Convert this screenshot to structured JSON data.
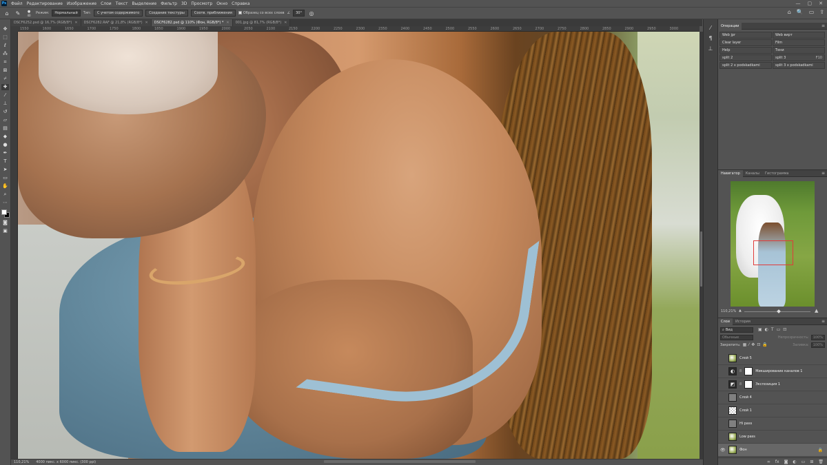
{
  "menubar": {
    "app_logo": "Ps",
    "items": [
      "Файл",
      "Редактирование",
      "Изображение",
      "Слои",
      "Текст",
      "Выделение",
      "Фильтр",
      "3D",
      "Просмотр",
      "Окно",
      "Справка"
    ],
    "controls": [
      "⌂",
      "🔍",
      "▭",
      "⇪",
      "—",
      "▢",
      "✕"
    ]
  },
  "options": {
    "brush_size": "40",
    "mode_label": "Режим:",
    "mode_value": "Нормальный",
    "type_label": "Тип:",
    "type_content_aware": "С учетом содержимого",
    "type_texture": "Создание текстуры",
    "type_proximity": "Соотв. приближения",
    "sample_all_layers": "Образец со всех слоев",
    "angle": "30°"
  },
  "tabs": [
    {
      "label": "DSCF6252.psd @ 16,7% (RGB/8*)",
      "active": false
    },
    {
      "label": "DSCF6282.RAF @ 21,8% (RGB/8*)",
      "active": false
    },
    {
      "label": "DSCF6282.psd @ 110% (Фон, RGB/8*) *",
      "active": true
    },
    {
      "label": "001.jpg @ 81,7% (RGB/8*)",
      "active": false
    }
  ],
  "ruler_ticks": [
    "1550",
    "1600",
    "1650",
    "1700",
    "1750",
    "1800",
    "1850",
    "1900",
    "1950",
    "2000",
    "2050",
    "2100",
    "2150",
    "2200",
    "2250",
    "2300",
    "2350",
    "2400",
    "2450",
    "2500",
    "2550",
    "2600",
    "2650",
    "2700",
    "2750",
    "2800",
    "2850",
    "2900",
    "2950",
    "3000"
  ],
  "status": {
    "zoom": "110,21%",
    "doc_info": "4000 пикс. x 6000 пикс. (300 ppi)"
  },
  "actions_panel": {
    "title": "Операции",
    "items": [
      {
        "label": "Web jpr",
        "shortcut": ""
      },
      {
        "label": "Web вирт",
        "shortcut": ""
      },
      {
        "label": "Clear layer",
        "shortcut": ""
      },
      {
        "label": "Film",
        "shortcut": ""
      },
      {
        "label": "Help",
        "shortcut": ""
      },
      {
        "label": "Тени",
        "shortcut": ""
      },
      {
        "label": "split 2",
        "shortcut": ""
      },
      {
        "label": "split 3",
        "shortcut": "F10"
      },
      {
        "label": "split 2 x podskadkami",
        "shortcut": ""
      },
      {
        "label": "split 3 x podskadkami",
        "shortcut": ""
      }
    ]
  },
  "navigator_panel": {
    "tabs": [
      "Навигатор",
      "Каналы",
      "Гистограмма"
    ],
    "zoom": "110,21%"
  },
  "layers_panel": {
    "tabs": [
      "Слои",
      "История"
    ],
    "filter_kind": "Вид",
    "blend_mode": "Обычные",
    "opacity_label": "Непрозрачность:",
    "opacity_value": "100%",
    "lock_label": "Закрепить:",
    "fill_label": "Заливка:",
    "fill_value": "100%",
    "layers": [
      {
        "name": "Слой 5",
        "thumb": "thumb-photo",
        "visible": false,
        "has_mask": false,
        "selected": false,
        "locked": false
      },
      {
        "name": "Микширование каналов 1",
        "thumb": "thumb-adj",
        "adj_icon": "◐",
        "visible": false,
        "has_mask": true,
        "selected": false,
        "locked": false
      },
      {
        "name": "Экспозиция 1",
        "thumb": "thumb-adj",
        "adj_icon": "◩",
        "visible": false,
        "has_mask": true,
        "selected": false,
        "locked": false
      },
      {
        "name": "Слой 4",
        "thumb": "thumb-gray",
        "visible": false,
        "has_mask": false,
        "selected": false,
        "locked": false
      },
      {
        "name": "Слой 1",
        "thumb": "thumb-trans",
        "visible": false,
        "has_mask": false,
        "selected": false,
        "locked": false
      },
      {
        "name": "Hi pass",
        "thumb": "thumb-gray",
        "visible": false,
        "has_mask": false,
        "selected": false,
        "locked": false
      },
      {
        "name": "Low pass",
        "thumb": "thumb-photo",
        "visible": false,
        "has_mask": false,
        "selected": false,
        "locked": false
      },
      {
        "name": "Фон",
        "thumb": "thumb-photo",
        "visible": true,
        "has_mask": false,
        "selected": true,
        "locked": true
      }
    ]
  }
}
